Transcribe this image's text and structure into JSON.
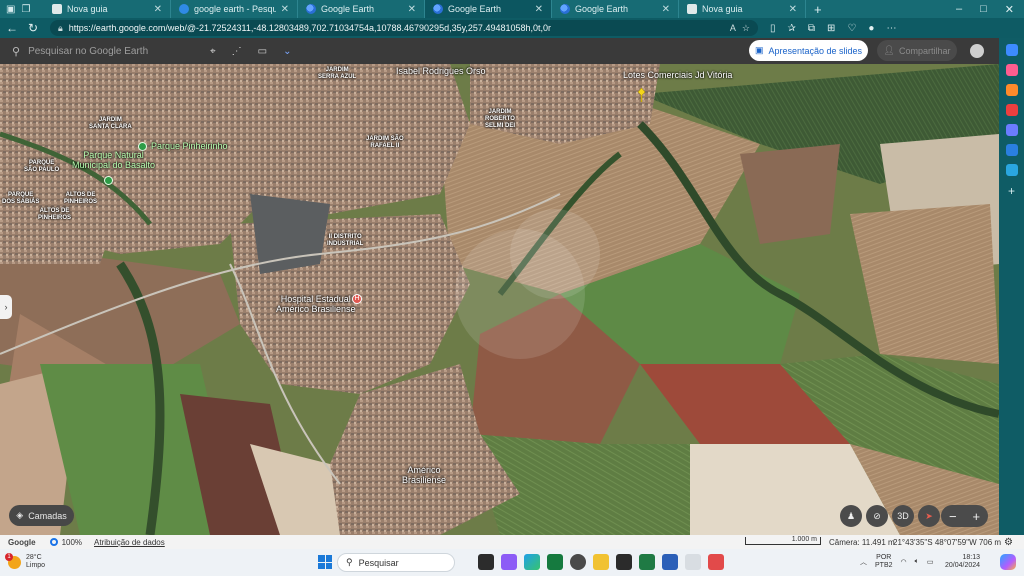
{
  "browser": {
    "tabs": [
      {
        "label": "Nova guia",
        "favicon": "new-tab-icon",
        "active": false
      },
      {
        "label": "google earth - Pesquisar",
        "favicon": "bing-icon",
        "active": false
      },
      {
        "label": "Google Earth",
        "favicon": "google-earth-icon",
        "active": false
      },
      {
        "label": "Google Earth",
        "favicon": "google-earth-icon",
        "active": true
      },
      {
        "label": "Google Earth",
        "favicon": "google-earth-icon",
        "active": false
      },
      {
        "label": "Nova guia",
        "favicon": "new-tab-icon",
        "active": false
      }
    ],
    "new_tab": "+",
    "url": "https://earth.google.com/web/@-21.72524311,-48.12803489,702.71034754a,10788.46790295d,35y,257.49481058h,0t,0r",
    "window_controls": [
      "–",
      "□",
      "✕"
    ]
  },
  "earth": {
    "search_placeholder": "Pesquisar no Google Earth",
    "slides_button": "Apresentação de slides",
    "share_button": "Compartilhar",
    "layers_button": "Camadas",
    "ctrl_3d": "3D",
    "zoom_minus": "−",
    "zoom_plus": "+",
    "map_labels": {
      "isabel": "Isabel Rodrigues Orso",
      "serra_azul": "JARDIM\nSERRA AZUL",
      "lotes": "Lotes Comerciais Jd Vitória",
      "roberto": "JARDIM\nROBERTO\nSELMI DEI",
      "santa_clara": "JARDIM\nSANTA CLARA",
      "parque_pinheirinho": "Parque Pinheirinho",
      "parque_natural": "Parque Natural\nMunicipal do Basalto",
      "sao_rafael": "JARDIM SÃO\nRAFAEL II",
      "sao_paulo": "PARQUE\nSÃO PAULO",
      "sabias": "PARQUE\nDOS SABIÁS",
      "altos_pinheiros": "ALTOS DE\nPINHEIROS",
      "altos_pinheiros2": "ALTOS DE\nPINHEIROS",
      "distrito": "II DISTRITO\nINDUSTRIAL",
      "hospital": "Hospital Estadual\nAmérico Brasiliense",
      "americo": "Américo\nBrasiliense"
    }
  },
  "status": {
    "google": "Google",
    "zoom": "100%",
    "attribution": "Atribuição de dados",
    "scale": "1.000 m",
    "camera": "Câmera: 11.491 m",
    "coords": "21°43'35\"S 48°07'59\"W  706 m"
  },
  "taskbar": {
    "weather_temp": "28°C",
    "weather_desc": "Limpo",
    "weather_badge": "1",
    "search": "Pesquisar",
    "lang_top": "POR",
    "lang_bottom": "PTB2",
    "time": "18:13",
    "date": "20/04/2024"
  },
  "colors": {
    "browser_accent": "#176b74",
    "earth_header": "#3a3a3a",
    "slides_text": "#1a63c9"
  }
}
